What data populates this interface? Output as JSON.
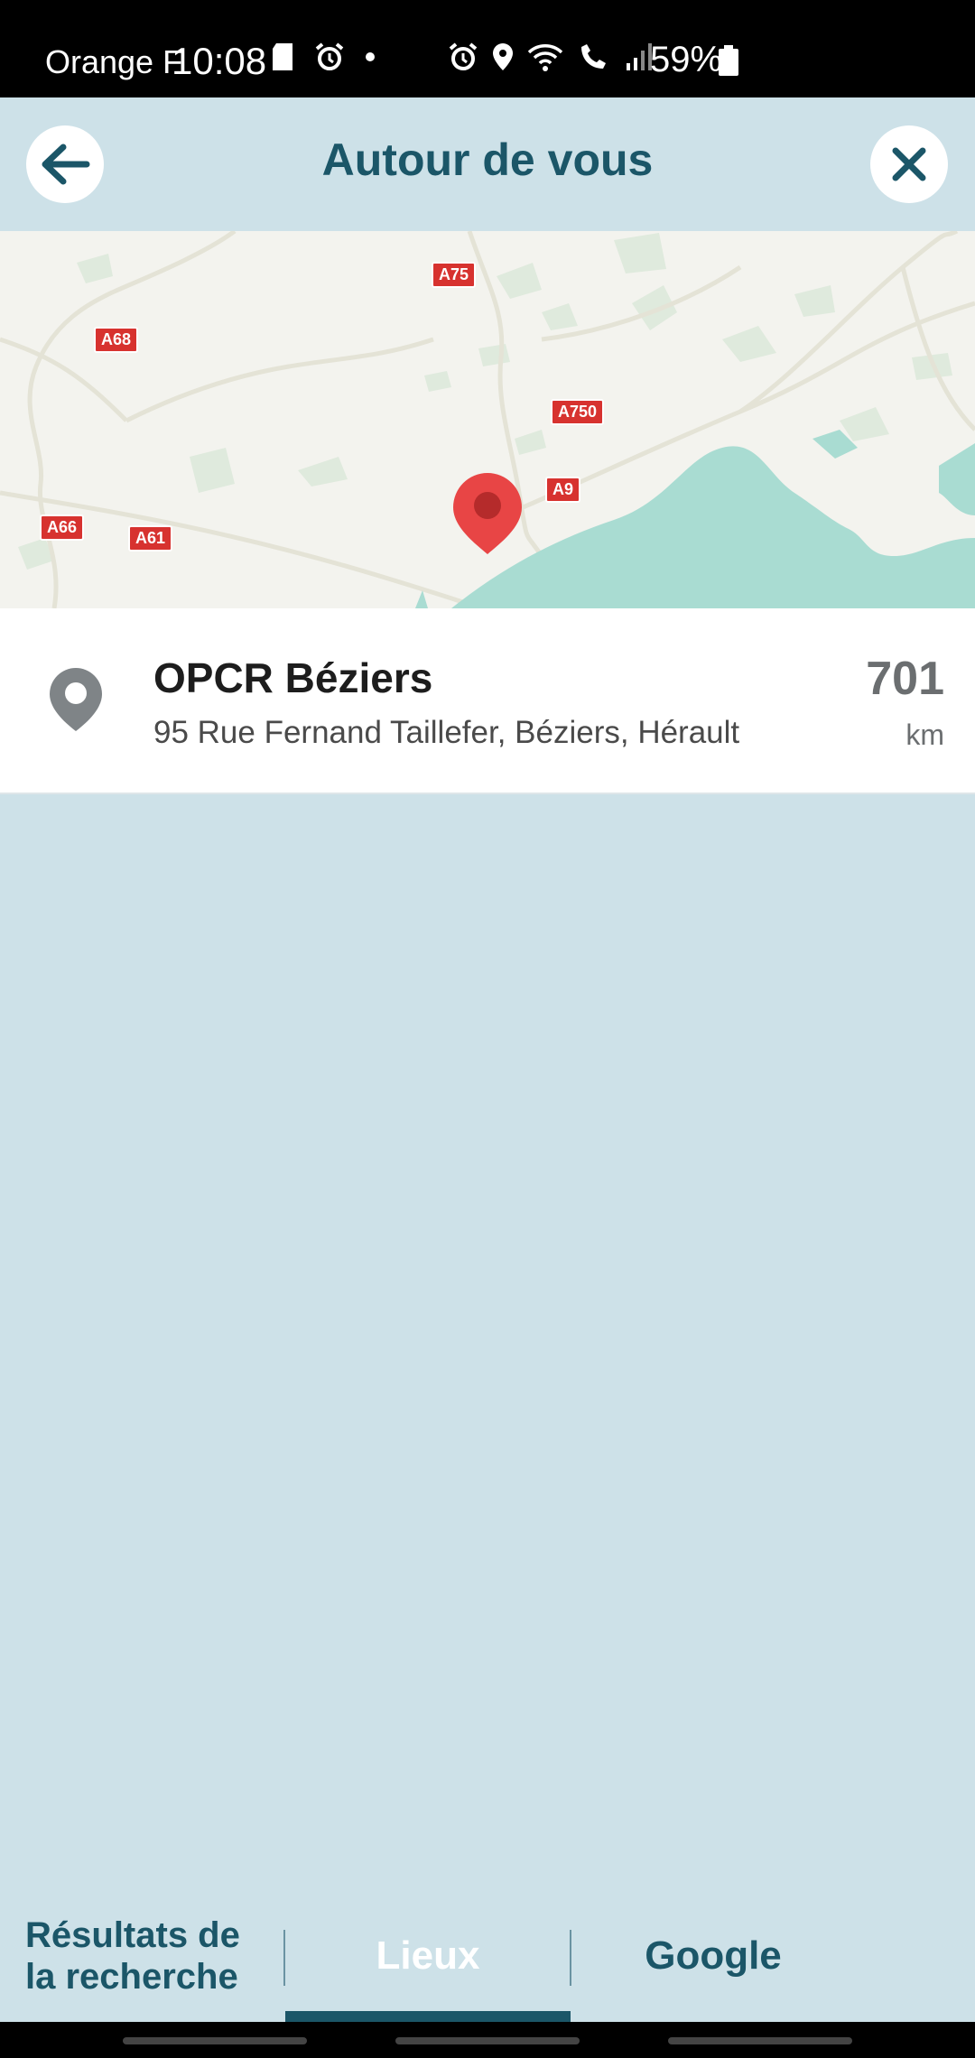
{
  "status_bar": {
    "carrier": "Orange F",
    "time": "10:08",
    "battery": "59%"
  },
  "header": {
    "title": "Autour de vous",
    "back_icon": "arrow-left-icon",
    "close_icon": "close-icon"
  },
  "map": {
    "road_labels": [
      "A75",
      "A68",
      "A750",
      "A9",
      "A66",
      "A61"
    ],
    "marker_icon": "map-marker-icon",
    "water_color": "#a9dcd2",
    "land_color": "#f3f3ee"
  },
  "result": {
    "name": "OPCR Béziers",
    "address": "95 Rue Fernand Taillefer, Béziers, Hérault",
    "distance": "701",
    "unit": "km",
    "icon": "location-pin-icon"
  },
  "tabs": {
    "results": "Résultats de la recherche",
    "places": "Lieux",
    "google": "Google",
    "active": "Lieux"
  },
  "colors": {
    "accent": "#1b5668",
    "background": "#cde1e8",
    "marker": "#e84545"
  }
}
